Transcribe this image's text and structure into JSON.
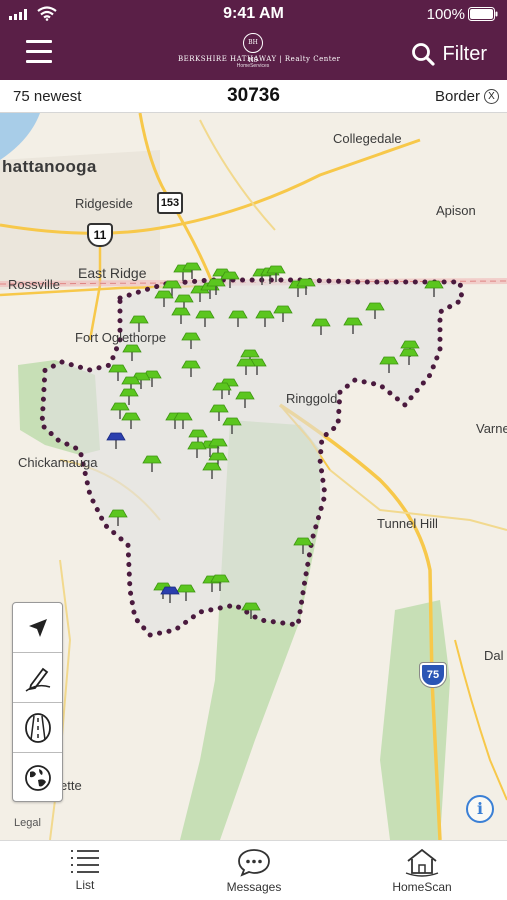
{
  "status_bar": {
    "time": "9:41 AM",
    "battery": "100%"
  },
  "nav": {
    "logo_seal": "BH HS",
    "logo_brand": "BERKSHIRE HATHAWAY",
    "logo_office": "Realty Center",
    "logo_sub": "HomeServices",
    "filter_label": "Filter"
  },
  "info_bar": {
    "newest": "75 newest",
    "zip": "30736",
    "border_label": "Border",
    "border_clear": "X"
  },
  "map": {
    "places": {
      "chattanooga": "hattanooga",
      "collegedale": "Collegedale",
      "ridgeside": "Ridgeside",
      "apison": "Apison",
      "east_ridge": "East Ridge",
      "rossville": "Rossville",
      "fort_oglethorpe": "Fort Oglethorpe",
      "ringgold": "Ringgold",
      "varnell": "Varne",
      "chickamauga": "Chickamauga",
      "tunnel_hill": "Tunnel Hill",
      "dalton": "Dal",
      "lafayette": "ette"
    },
    "shields": {
      "route153": "153",
      "route11": "11",
      "interstate": "75"
    },
    "legal": "Legal",
    "info": "i",
    "colors": {
      "pin_green": "#5bc61f",
      "pin_blue": "#2b3fae",
      "border_dots": "#4a1a3e",
      "park": "#c7dfb6",
      "road": "#f7c84a"
    }
  },
  "tools": [
    "location-arrow-icon",
    "pencil-draw-icon",
    "road-icon",
    "globe-icon"
  ],
  "tabs": [
    {
      "label": "List",
      "icon": "list-icon"
    },
    {
      "label": "Messages",
      "icon": "chat-bubble-icon"
    },
    {
      "label": "HomeScan",
      "icon": "house-scan-icon"
    }
  ]
}
